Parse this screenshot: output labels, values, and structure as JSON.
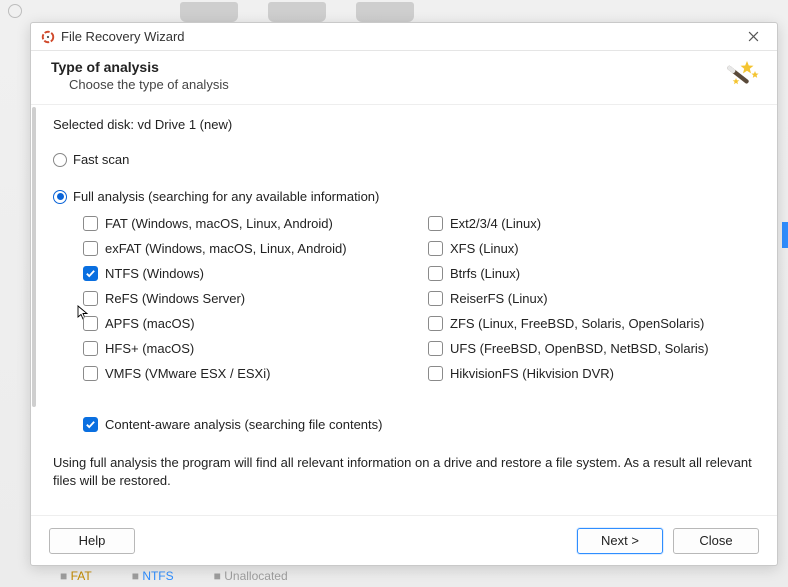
{
  "window": {
    "title": "File Recovery Wizard"
  },
  "header": {
    "title": "Type of analysis",
    "subtitle": "Choose the type of analysis"
  },
  "selected_disk": {
    "label_prefix": "Selected disk: ",
    "value": "vd Drive 1 (new)"
  },
  "radios": {
    "fast": {
      "label": "Fast scan",
      "selected": false
    },
    "full": {
      "label": "Full analysis (searching for any available information)",
      "selected": true
    }
  },
  "fs": {
    "left": [
      {
        "key": "fat",
        "label": "FAT (Windows, macOS, Linux, Android)",
        "checked": false
      },
      {
        "key": "exfat",
        "label": "exFAT (Windows, macOS, Linux, Android)",
        "checked": false
      },
      {
        "key": "ntfs",
        "label": "NTFS (Windows)",
        "checked": true
      },
      {
        "key": "refs",
        "label": "ReFS (Windows Server)",
        "checked": false
      },
      {
        "key": "apfs",
        "label": "APFS (macOS)",
        "checked": false
      },
      {
        "key": "hfs",
        "label": "HFS+ (macOS)",
        "checked": false
      },
      {
        "key": "vmfs",
        "label": "VMFS (VMware ESX / ESXi)",
        "checked": false
      }
    ],
    "right": [
      {
        "key": "ext",
        "label": "Ext2/3/4 (Linux)",
        "checked": false
      },
      {
        "key": "xfs",
        "label": "XFS (Linux)",
        "checked": false
      },
      {
        "key": "btrfs",
        "label": "Btrfs (Linux)",
        "checked": false
      },
      {
        "key": "reiserfs",
        "label": "ReiserFS (Linux)",
        "checked": false
      },
      {
        "key": "zfs",
        "label": "ZFS (Linux, FreeBSD, Solaris, OpenSolaris)",
        "checked": false
      },
      {
        "key": "ufs",
        "label": "UFS (FreeBSD, OpenBSD, NetBSD, Solaris)",
        "checked": false
      },
      {
        "key": "hikfs",
        "label": "HikvisionFS (Hikvision DVR)",
        "checked": false
      }
    ]
  },
  "content_aware": {
    "label": "Content-aware analysis (searching file contents)",
    "checked": true
  },
  "description": "Using full analysis the program will find all relevant information on a drive and restore a file system. As a result all relevant files will be restored.",
  "buttons": {
    "help": "Help",
    "next": "Next >",
    "close": "Close"
  },
  "statusbar": {
    "fat": "FAT",
    "ntfs": "NTFS",
    "unalloc": "Unallocated"
  }
}
